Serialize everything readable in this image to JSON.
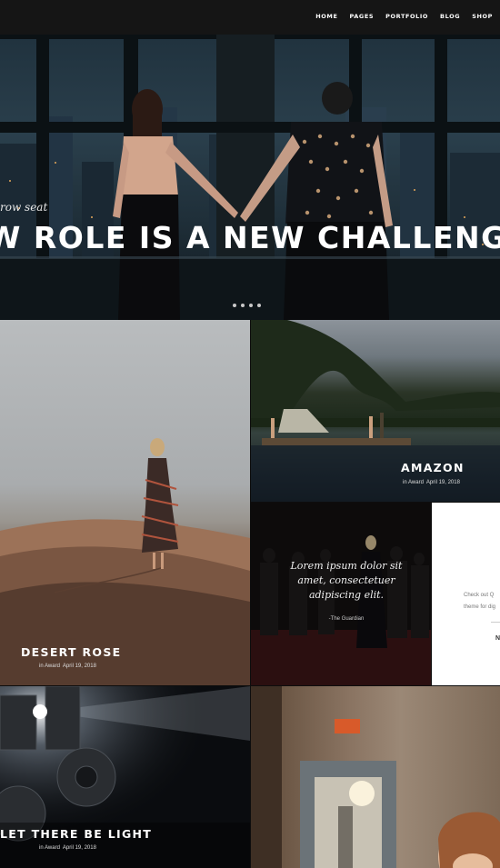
{
  "nav": {
    "items": [
      "HOME",
      "PAGES",
      "PORTFOLIO",
      "BLOG",
      "SHOP"
    ]
  },
  "hero": {
    "subtitle": "row seat",
    "title": "W ROLE IS A NEW CHALLENGE",
    "slide_count": 4
  },
  "tiles": {
    "desert": {
      "title": "DESERT ROSE",
      "category": "in Award",
      "date": "April 19, 2018"
    },
    "amazon": {
      "title": "AMAZON",
      "category": "in Award",
      "date": "April 19, 2018"
    },
    "quote": {
      "text": "Lorem ipsum dolor sit amet, consectetuer adipiscing elit.",
      "source": "-The Guardian"
    },
    "white": {
      "line1": "Check out Q",
      "line2": "theme for dig",
      "initial": "N"
    },
    "light": {
      "title": "LET THERE BE LIGHT",
      "category": "in Award",
      "date": "April 19, 2018"
    }
  },
  "colors": {
    "nav_bg": "#151515",
    "page_bg": "#0d0d0d",
    "text": "#ffffff"
  }
}
